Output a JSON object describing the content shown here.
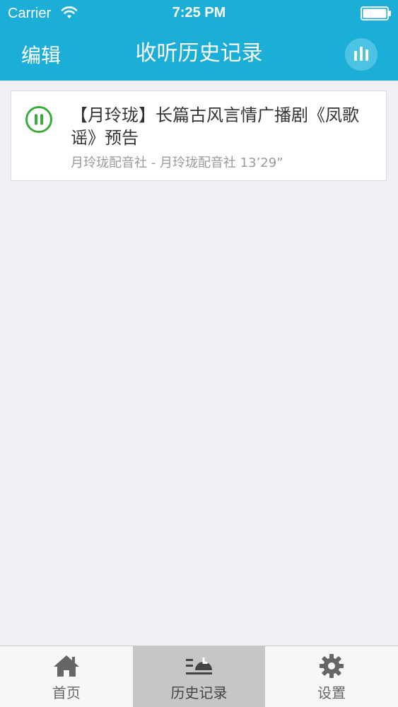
{
  "status_bar": {
    "carrier": "Carrier",
    "time": "7:25 PM",
    "wifi_icon": "wifi-icon",
    "battery_icon": "battery-icon"
  },
  "header": {
    "edit_label": "编辑",
    "title": "收听历史记录",
    "equalizer_icon": "equalizer-icon",
    "background_color": "#1bafd8"
  },
  "history": {
    "items": [
      {
        "title": "【月玲珑】长篇古风言情广播剧《凤歌谣》预告",
        "meta": "月玲珑配音社 - 月玲珑配音社  13’29”",
        "state_icon": "pause-icon",
        "state_color": "#3aac3a"
      }
    ]
  },
  "tab_bar": {
    "tabs": [
      {
        "label": "首页",
        "icon": "home-icon",
        "active": false
      },
      {
        "label": "历史记录",
        "icon": "history-icon",
        "active": true
      },
      {
        "label": "设置",
        "icon": "gear-icon",
        "active": false
      }
    ]
  }
}
